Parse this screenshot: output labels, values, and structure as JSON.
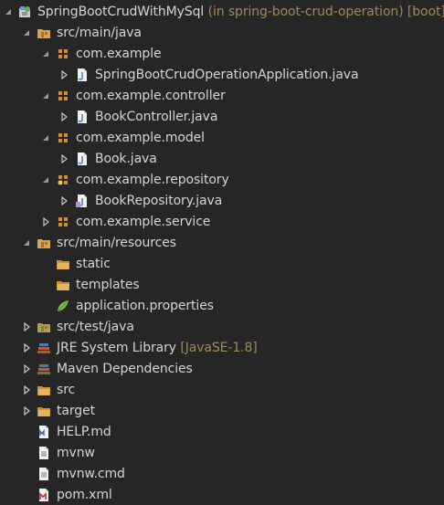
{
  "tree": {
    "items": [
      {
        "label": "SpringBootCrudWithMySql",
        "decoration": "(in spring-boot-crud-operation) [boot]",
        "icon": "boot-project-icon",
        "expanded": true,
        "arrow": "expanded"
      },
      {
        "label": "src/main/java",
        "icon": "source-folder-icon",
        "arrow": "expanded"
      },
      {
        "label": "com.example",
        "icon": "package-icon",
        "arrow": "expanded"
      },
      {
        "label": "SpringBootCrudOperationApplication.java",
        "icon": "java-file-icon",
        "arrow": "collapsed"
      },
      {
        "label": "com.example.controller",
        "icon": "package-icon",
        "arrow": "expanded"
      },
      {
        "label": "BookController.java",
        "icon": "java-file-icon",
        "arrow": "collapsed"
      },
      {
        "label": "com.example.model",
        "icon": "package-icon",
        "arrow": "expanded"
      },
      {
        "label": "Book.java",
        "icon": "java-file-icon",
        "arrow": "collapsed"
      },
      {
        "label": "com.example.repository",
        "icon": "package-icon",
        "arrow": "expanded"
      },
      {
        "label": "BookRepository.java",
        "icon": "java-interface-file-icon",
        "arrow": "collapsed"
      },
      {
        "label": "com.example.service",
        "icon": "package-icon",
        "arrow": "collapsed"
      },
      {
        "label": "src/main/resources",
        "icon": "source-folder-icon",
        "arrow": "expanded"
      },
      {
        "label": "static",
        "icon": "folder-icon",
        "arrow": "none"
      },
      {
        "label": "templates",
        "icon": "folder-icon",
        "arrow": "none"
      },
      {
        "label": "application.properties",
        "icon": "properties-file-icon",
        "arrow": "none"
      },
      {
        "label": "src/test/java",
        "icon": "source-folder-icon",
        "arrow": "collapsed"
      },
      {
        "label": "JRE System Library",
        "decoration": "[JavaSE-1.8]",
        "icon": "library-icon",
        "arrow": "collapsed"
      },
      {
        "label": "Maven Dependencies",
        "icon": "library-icon",
        "arrow": "collapsed"
      },
      {
        "label": "src",
        "icon": "folder-icon",
        "arrow": "collapsed"
      },
      {
        "label": "target",
        "icon": "folder-icon",
        "arrow": "collapsed"
      },
      {
        "label": "HELP.md",
        "icon": "markdown-file-icon",
        "arrow": "none"
      },
      {
        "label": "mvnw",
        "icon": "text-file-icon",
        "arrow": "none"
      },
      {
        "label": "mvnw.cmd",
        "icon": "text-file-icon",
        "arrow": "none"
      },
      {
        "label": "pom.xml",
        "icon": "maven-pom-icon",
        "arrow": "none"
      }
    ]
  },
  "colors": {
    "background": "#262626",
    "text": "#d6d6d6",
    "decoration": "#a38a5b",
    "package": "#d88a2c",
    "folder": "#e6b45a",
    "java": "#5f8fd1"
  }
}
